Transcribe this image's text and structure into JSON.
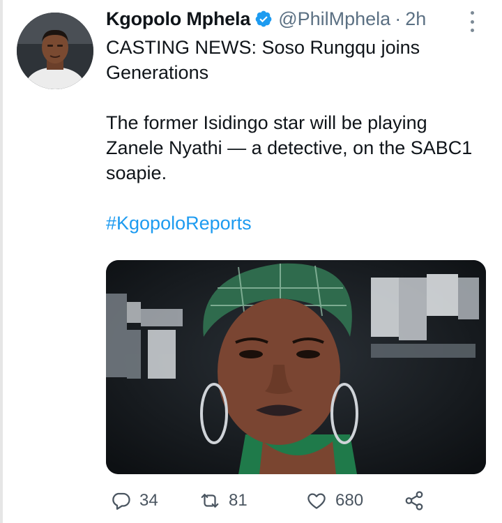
{
  "tweet": {
    "display_name": "Kgopolo Mphela",
    "handle": "@PhilMphela",
    "separator": "·",
    "time": "2h",
    "verified_icon": "verified-badge-icon",
    "text_line1": "CASTING NEWS: Soso Rungqu joins Generations",
    "text_line2": "The former Isidingo star will be playing Zanele Nyathi — a detective, on the SABC1 soapie.",
    "hashtag": "#KgopoloReports"
  },
  "actions": {
    "reply_count": "34",
    "retweet_count": "81",
    "like_count": "680"
  },
  "icons": [
    "more-icon",
    "reply-icon",
    "retweet-icon",
    "like-icon",
    "share-icon"
  ],
  "colors": {
    "link": "#1d9bf0",
    "secondary_text": "#5b7083",
    "verified": "#1d9bf0"
  }
}
